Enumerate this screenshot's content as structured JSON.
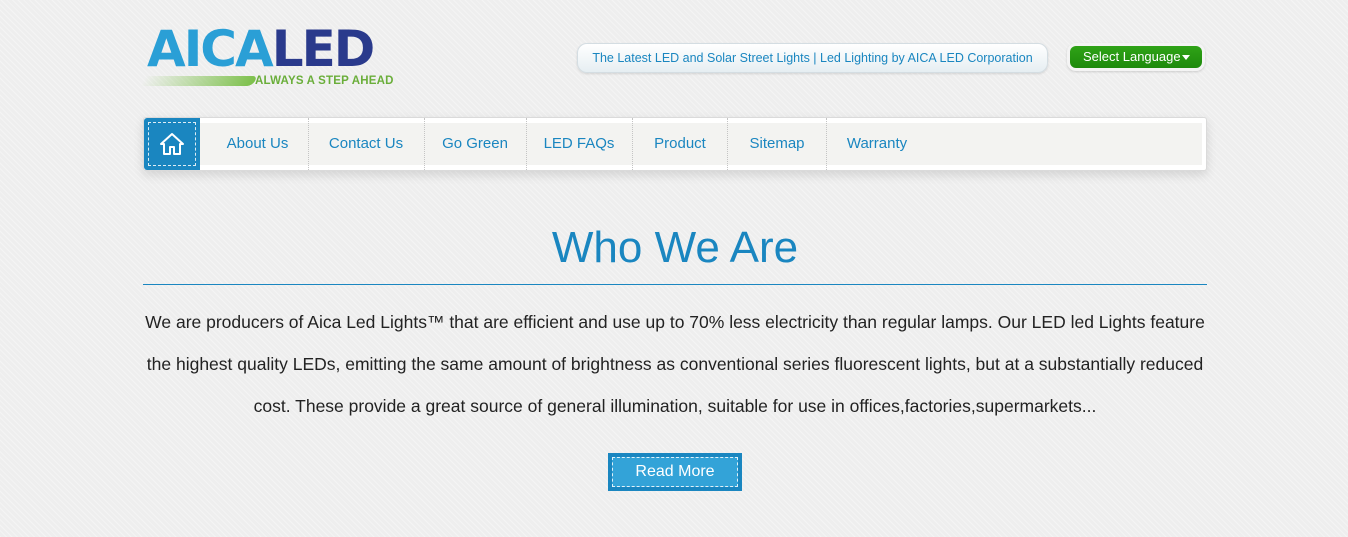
{
  "logo": {
    "brand_part1": "AICA",
    "brand_part2": "LED",
    "tagline": "ALWAYS A STEP AHEAD"
  },
  "header": {
    "site_tagline": "The Latest LED and Solar Street Lights | Led Lighting by AICA LED Corporation",
    "language_select": {
      "selected": "Select Language",
      "icon": "chevron-down-icon"
    }
  },
  "nav": {
    "home_icon": "home-icon",
    "items": [
      {
        "label": "About Us"
      },
      {
        "label": "Contact Us"
      },
      {
        "label": "Go Green"
      },
      {
        "label": "LED FAQs"
      },
      {
        "label": "Product"
      },
      {
        "label": "Sitemap"
      },
      {
        "label": "Warranty"
      }
    ]
  },
  "main": {
    "title": "Who We Are",
    "body": "We are producers of Aica Led Lights™ that are efficient and use up to 70% less electricity than regular lamps. Our LED led Lights feature the highest quality LEDs, emitting the same amount of brightness as conventional series fluorescent lights, but at a substantially reduced cost. These provide a great source of general illumination, suitable for use in offices,factories,supermarkets...",
    "read_more": "Read More"
  },
  "colors": {
    "accent": "#1a86c0",
    "language_button": "#2a9a15",
    "logo_light_blue": "#2a9fd6",
    "logo_dark_blue": "#2a3a8c",
    "logo_green": "#6aae3a"
  }
}
